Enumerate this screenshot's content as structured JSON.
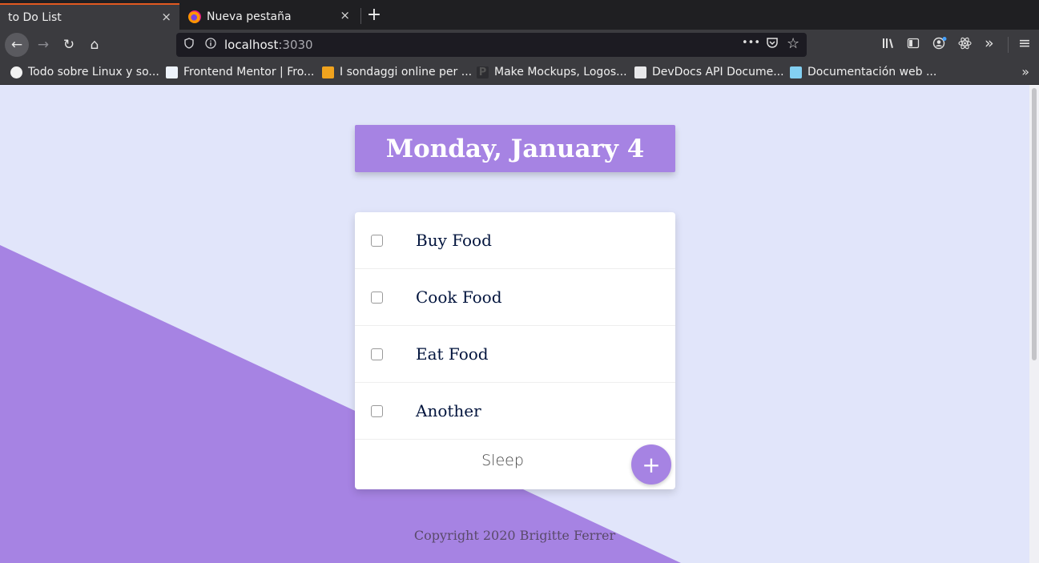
{
  "browser": {
    "tabs": [
      {
        "title": "to Do List",
        "active": true
      },
      {
        "title": "Nueva pestaña",
        "active": false
      }
    ],
    "url": {
      "host": "localhost",
      "port": ":3030"
    },
    "bookmarks": [
      "Todo sobre Linux y so...",
      "Frontend Mentor | Fro...",
      "I sondaggi online per ...",
      "Make Mockups, Logos...",
      "DevDocs API Docume...",
      "Documentación web ..."
    ],
    "icons": {
      "close": "×",
      "new_tab": "+",
      "back": "←",
      "forward": "→",
      "reload": "↻",
      "home": "⌂",
      "more": "•••",
      "star": "☆",
      "overflow": "»",
      "menu": "≡"
    }
  },
  "app": {
    "date_heading": "Monday, January 4",
    "todos": [
      {
        "text": "Buy Food",
        "checked": false
      },
      {
        "text": "Cook Food",
        "checked": false
      },
      {
        "text": "Eat Food",
        "checked": false
      },
      {
        "text": "Another",
        "checked": false
      }
    ],
    "new_item_value": "Sleep",
    "add_button_label": "+",
    "footer": "Copyright 2020 Brigitte Ferrer",
    "colors": {
      "accent": "#a683e3",
      "background": "#e1e5fa",
      "text": "#02143d"
    }
  }
}
